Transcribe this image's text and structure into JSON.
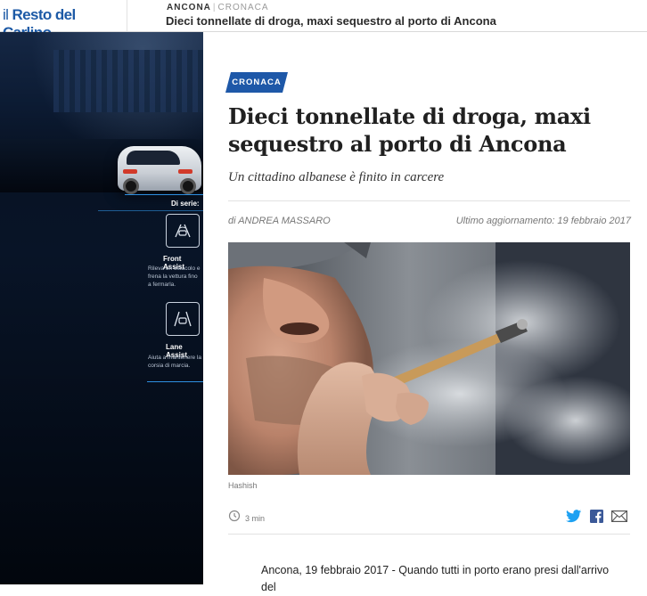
{
  "header": {
    "logo": {
      "part1": "il",
      "part2": "Resto del",
      "part3": "Carlino"
    },
    "breadcrumb": {
      "section": "ANCONA",
      "category": "CRONACA"
    },
    "title": "Dieci tonnellate di droga, maxi sequestro al porto di Ancona"
  },
  "ad": {
    "standard_label": "Di serie:",
    "features": [
      {
        "name": "Front Assist",
        "description": "Rileva un ostacolo e frena la vettura fino a fermarla.",
        "icon": "front-assist-icon"
      },
      {
        "name": "Lane Assist",
        "description": "Aiuta a mantenere la corsia di marcia.",
        "icon": "lane-assist-icon"
      }
    ]
  },
  "article": {
    "category_badge": "CRONACA",
    "title": "Dieci tonnellate di droga, maxi sequestro al porto di Ancona",
    "subtitle": "Un cittadino albanese è finito in carcere",
    "byline": "di ANDREA MASSARO",
    "updated": "Ultimo aggiornamento: 19 febbraio 2017",
    "image_caption": "Hashish",
    "read_time": "3 min",
    "body_first_line": "Ancona, 19 febbraio 2017 - Quando tutti in porto erano presi dall'arrivo del",
    "share_icons": [
      "twitter-icon",
      "facebook-icon",
      "email-icon"
    ]
  },
  "colors": {
    "brand_blue": "#1e58a8",
    "logo_blue": "#1d5aa6",
    "twitter_blue": "#1da1f2",
    "facebook_blue": "#3b5998"
  }
}
